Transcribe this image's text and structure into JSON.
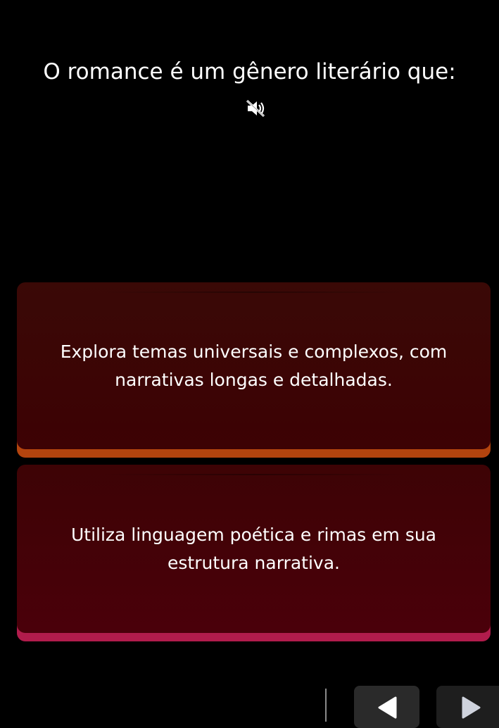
{
  "question": {
    "text": "O romance é um gênero literário que:",
    "audio_icon": "speaker-muted-icon"
  },
  "options": [
    {
      "label": "Explora temas universais e complexos, com narrativas longas e detalhadas.",
      "color": "#3d0104",
      "accent_color": "#b3440e"
    },
    {
      "label": "Utiliza linguagem poética e rimas em sua estrutura narrativa.",
      "color": "#4b000a",
      "accent_color": "#b11c4c"
    }
  ],
  "navigation": {
    "prev_icon": "arrow-left-icon",
    "next_icon": "arrow-right-icon"
  }
}
